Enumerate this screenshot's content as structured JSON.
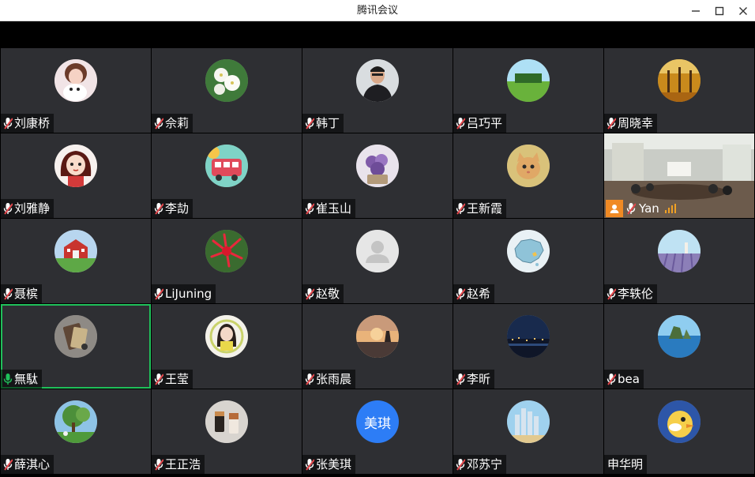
{
  "window": {
    "title": "腾讯会议"
  },
  "participants": [
    {
      "name": "刘康桥",
      "avatar": "girl-dog-photo",
      "mic": "muted"
    },
    {
      "name": "佘莉",
      "avatar": "white-flowers-photo",
      "mic": "muted"
    },
    {
      "name": "韩丁",
      "avatar": "man-portrait-photo",
      "mic": "muted"
    },
    {
      "name": "吕巧平",
      "avatar": "green-field-photo",
      "mic": "muted"
    },
    {
      "name": "周晓幸",
      "avatar": "autumn-trees-photo",
      "mic": "muted"
    },
    {
      "name": "刘雅静",
      "avatar": "cartoon-girl",
      "mic": "muted"
    },
    {
      "name": "李劼",
      "avatar": "red-bus-illustration",
      "mic": "muted"
    },
    {
      "name": "崔玉山",
      "avatar": "purple-flowers-photo",
      "mic": "muted"
    },
    {
      "name": "王新霞",
      "avatar": "kitten-photo",
      "mic": "muted"
    },
    {
      "name": "Yan",
      "avatar": "meeting-room-video",
      "mic": "muted",
      "video": true
    },
    {
      "name": "聂槟",
      "avatar": "red-barn-painting",
      "mic": "muted"
    },
    {
      "name": "LiJuning",
      "avatar": "red-lily-photo",
      "mic": "muted"
    },
    {
      "name": "赵敬",
      "avatar": "default-person-icon",
      "mic": "muted"
    },
    {
      "name": "赵希",
      "avatar": "china-map",
      "mic": "muted"
    },
    {
      "name": "李轶伦",
      "avatar": "lavender-field-photo",
      "mic": "muted"
    },
    {
      "name": "無駄",
      "avatar": "book-object-photo",
      "mic": "active",
      "active": true
    },
    {
      "name": "王莹",
      "avatar": "girl-wreath-illustration",
      "mic": "muted"
    },
    {
      "name": "张雨晨",
      "avatar": "sunset-silhouette-photo",
      "mic": "muted"
    },
    {
      "name": "李昕",
      "avatar": "night-city-photo",
      "mic": "muted"
    },
    {
      "name": "bea",
      "avatar": "sea-rock-photo",
      "mic": "muted"
    },
    {
      "name": "薛淇心",
      "avatar": "garden-tree-photo",
      "mic": "muted"
    },
    {
      "name": "王正浩",
      "avatar": "lipstick-photo",
      "mic": "muted"
    },
    {
      "name": "张美琪",
      "avatar": "text-avatar",
      "avatar_text": "美琪",
      "mic": "muted"
    },
    {
      "name": "邓苏宁",
      "avatar": "city-skyline-photo",
      "mic": "muted"
    },
    {
      "name": "申华明",
      "avatar": "cartoon-duck",
      "mic": "none"
    }
  ],
  "colors": {
    "tile": "#2e2f33",
    "active_border": "#1fc05a",
    "mic_muted": "#e5484d",
    "mic_active": "#1fc05a",
    "text_avatar": "#2d7df6",
    "badge": "#f08a24"
  }
}
